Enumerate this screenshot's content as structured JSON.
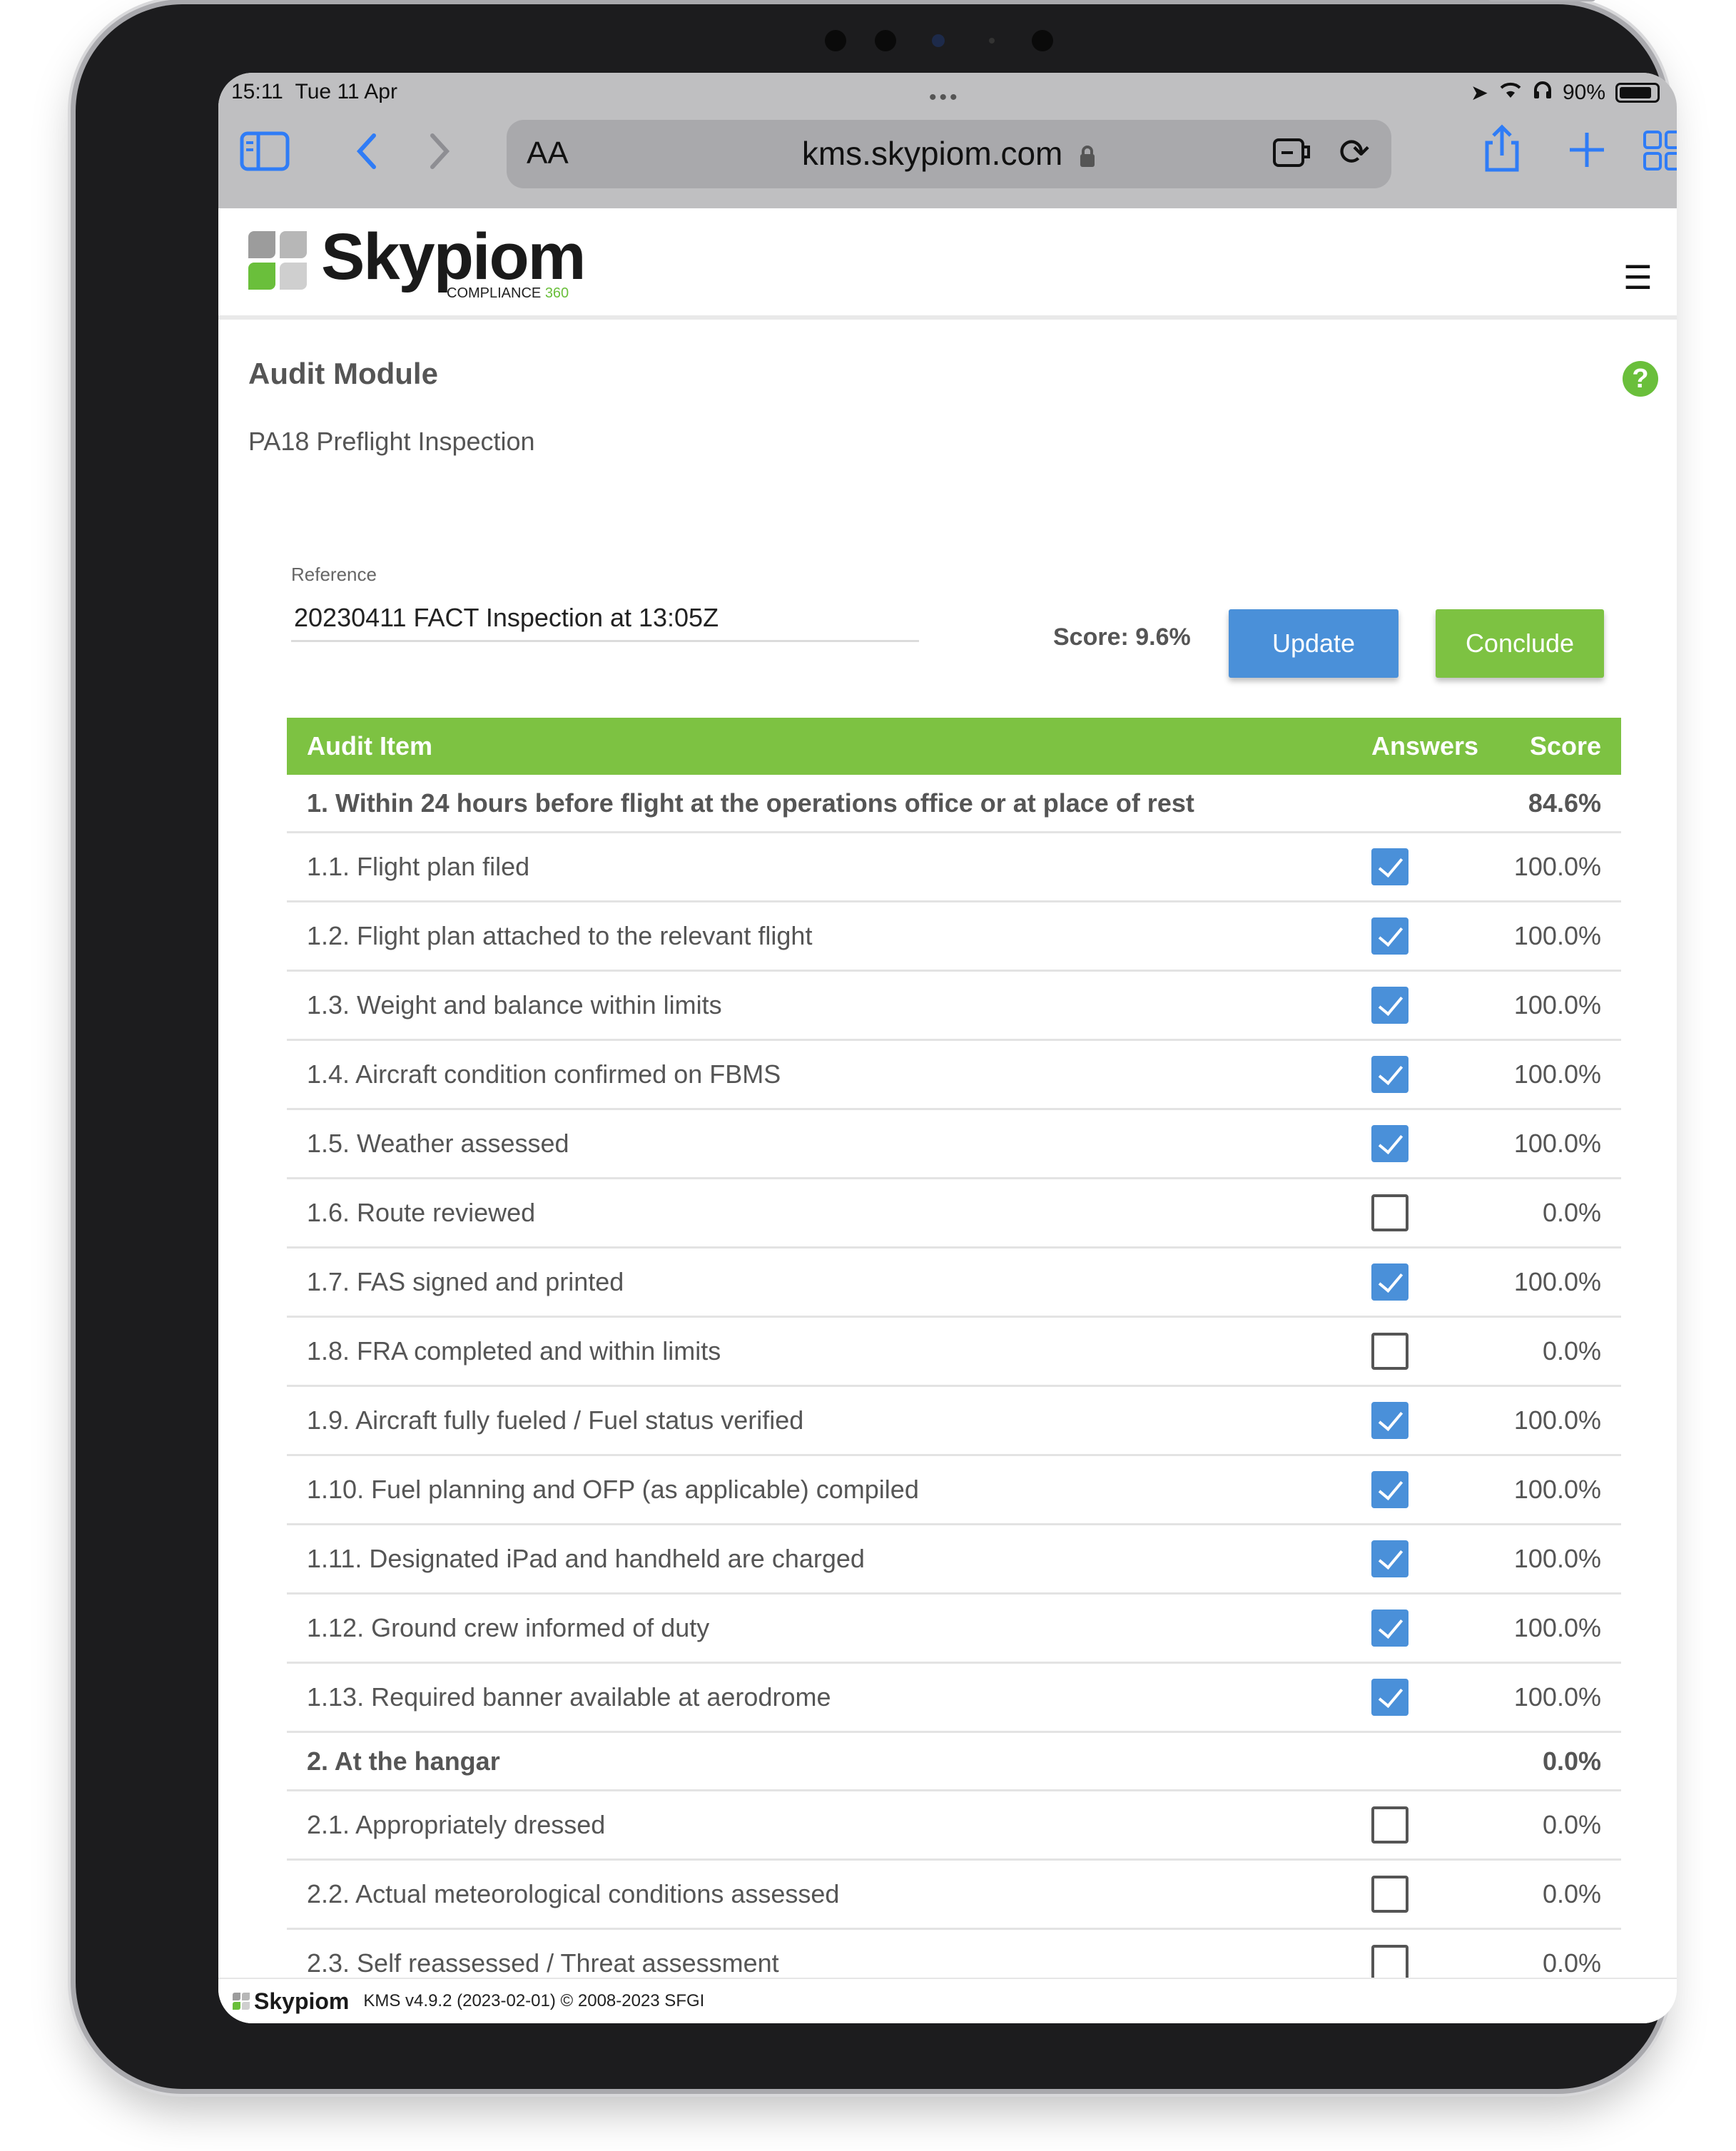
{
  "status_bar": {
    "time": "15:11",
    "date": "Tue 11 Apr",
    "battery": "90%"
  },
  "browser": {
    "text_size_label": "AA",
    "url": "kms.skypiom.com",
    "icons": [
      "sidebar-icon",
      "back-icon",
      "forward-icon",
      "lock-icon",
      "extension-icon",
      "reload-icon",
      "share-icon",
      "new-tab-icon",
      "tabs-icon"
    ]
  },
  "brand": {
    "name": "Skypiom",
    "tagline": "COMPLIANCE",
    "tagline_number": "360",
    "green": "#7dc242",
    "blue": "#4a90d9"
  },
  "page": {
    "module_title": "Audit Module",
    "audit_name": "PA18 Preflight Inspection",
    "help_label": "?"
  },
  "form": {
    "reference_label": "Reference",
    "reference_value": "20230411 FACT Inspection at 13:05Z",
    "score_label": "Score: 9.6%",
    "update_label": "Update",
    "conclude_label": "Conclude"
  },
  "table": {
    "headers": {
      "item": "Audit Item",
      "answers": "Answers",
      "score": "Score"
    },
    "rows": [
      {
        "type": "section",
        "label": "1. Within 24 hours before flight at the operations office or at place of rest",
        "score": "84.6%"
      },
      {
        "type": "item",
        "label": "1.1. Flight plan filed",
        "checked": true,
        "score": "100.0%"
      },
      {
        "type": "item",
        "label": "1.2. Flight plan attached to the relevant flight",
        "checked": true,
        "score": "100.0%"
      },
      {
        "type": "item",
        "label": "1.3. Weight and balance within limits",
        "checked": true,
        "score": "100.0%"
      },
      {
        "type": "item",
        "label": "1.4. Aircraft condition confirmed on FBMS",
        "checked": true,
        "score": "100.0%"
      },
      {
        "type": "item",
        "label": "1.5. Weather assessed",
        "checked": true,
        "score": "100.0%"
      },
      {
        "type": "item",
        "label": "1.6. Route reviewed",
        "checked": false,
        "score": "0.0%"
      },
      {
        "type": "item",
        "label": "1.7. FAS signed and printed",
        "checked": true,
        "score": "100.0%"
      },
      {
        "type": "item",
        "label": "1.8. FRA completed and within limits",
        "checked": false,
        "score": "0.0%"
      },
      {
        "type": "item",
        "label": "1.9. Aircraft fully fueled / Fuel status verified",
        "checked": true,
        "score": "100.0%"
      },
      {
        "type": "item",
        "label": "1.10. Fuel planning and OFP (as applicable) compiled",
        "checked": true,
        "score": "100.0%"
      },
      {
        "type": "item",
        "label": "1.11. Designated iPad and handheld are charged",
        "checked": true,
        "score": "100.0%"
      },
      {
        "type": "item",
        "label": "1.12. Ground crew informed of duty",
        "checked": true,
        "score": "100.0%"
      },
      {
        "type": "item",
        "label": "1.13. Required banner available at aerodrome",
        "checked": true,
        "score": "100.0%"
      },
      {
        "type": "section",
        "label": "2. At the hangar",
        "score": "0.0%"
      },
      {
        "type": "item",
        "label": "2.1. Appropriately dressed",
        "checked": false,
        "score": "0.0%"
      },
      {
        "type": "item",
        "label": "2.2. Actual meteorological conditions assessed",
        "checked": false,
        "score": "0.0%"
      },
      {
        "type": "item",
        "label": "2.3. Self reassessed / Threat assessment",
        "checked": false,
        "score": "0.0%"
      }
    ]
  },
  "footer": {
    "brand": "Skypiom",
    "version": "KMS v4.9.2 (2023-02-01) © 2008-2023 SFGI"
  }
}
